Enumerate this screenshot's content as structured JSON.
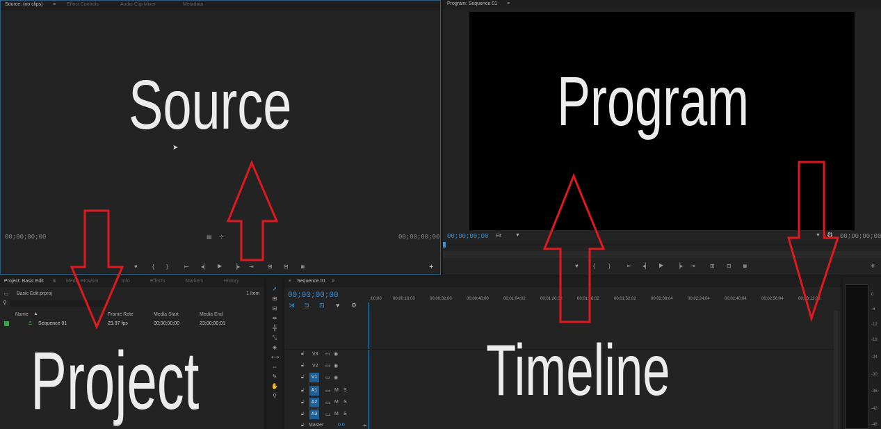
{
  "source_panel": {
    "tabs": [
      "Source: (no clips)",
      "Effect Controls",
      "Audio Clip Mixer",
      "Metadata"
    ],
    "tc_left": "00;00;00;00",
    "tc_right": "00;00;00;00",
    "big_label": "Source"
  },
  "program_panel": {
    "tab": "Program: Sequence 01",
    "tc_left": "00;00;00;00",
    "fit": "Fit",
    "tc_right": "00;00;00;00",
    "big_label": "Program"
  },
  "project_panel": {
    "tabs": [
      "Project: Basic Edit",
      "Media Browser",
      "Info",
      "Effects",
      "Markers",
      "History"
    ],
    "file": "Basic Edit.prproj",
    "item_count": "1 Item",
    "columns": [
      "Name",
      "Frame Rate",
      "Media Start",
      "Media End"
    ],
    "row": {
      "name": "Sequence 01",
      "frame_rate": "29.97 fps",
      "media_start": "00;00;00;00",
      "media_end": "23;00;00;01"
    },
    "big_label": "Project"
  },
  "timeline_panel": {
    "tab": "Sequence 01",
    "tc": "00;00;00;00",
    "ruler": [
      ":00;00",
      "00;00;16;00",
      "00;00;32;00",
      "00;00;48;00",
      "00;01;04;02",
      "00;01;20;02",
      "00;01;36;02",
      "00;01;52;02",
      "00;02;08;04",
      "00;02;24;04",
      "00;02;40;04",
      "00;02;56;04",
      "00;03;12;06"
    ],
    "video_tracks": [
      "V3",
      "V2",
      "V1"
    ],
    "audio_tracks": [
      "A1",
      "A2",
      "A3"
    ],
    "master": "Master",
    "master_val": "0.0",
    "mute": "M",
    "solo": "S",
    "big_label": "Timeline"
  },
  "meters": {
    "labels": [
      "0",
      "-6",
      "-12",
      "-18",
      "-24",
      "-30",
      "-36",
      "-42",
      "-48"
    ]
  },
  "icons": {
    "plus": "+",
    "menu": "≡",
    "arrow_color": "#e0191f"
  }
}
